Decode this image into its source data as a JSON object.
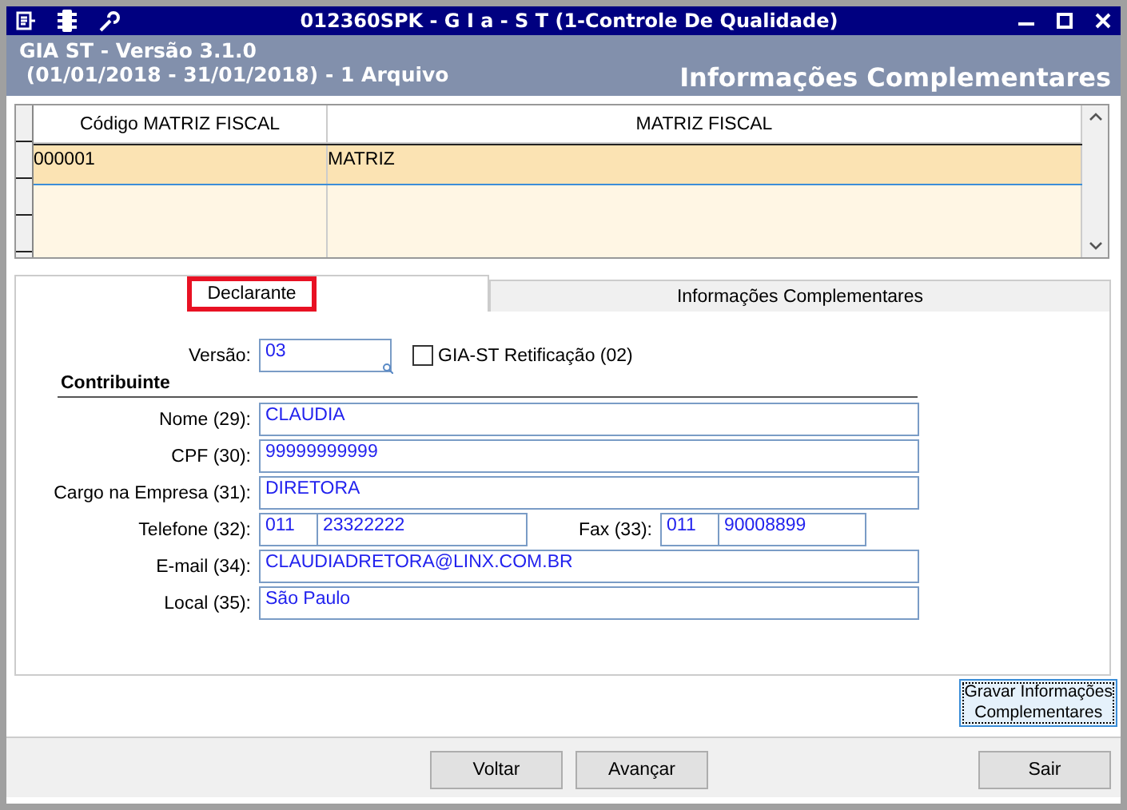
{
  "window": {
    "title": "012360SPK - G I a - S T (1-Controle De Qualidade)"
  },
  "header": {
    "line1": "GIA ST - Versão 3.1.0",
    "line2": " (01/01/2018 - 31/01/2018) - 1 Arquivo",
    "section": "Informações Complementares"
  },
  "table": {
    "columns": [
      "Código MATRIZ FISCAL",
      "MATRIZ FISCAL"
    ],
    "rows": [
      {
        "cells": [
          "000001",
          "MATRIZ"
        ],
        "selected": true
      }
    ]
  },
  "tabs": [
    {
      "label": "Declarante",
      "selected": true,
      "highlighted": true
    },
    {
      "label": "Informações Complementares",
      "selected": false,
      "highlighted": false
    }
  ],
  "form": {
    "version": {
      "label": "Versão:",
      "value": "03"
    },
    "rectification": {
      "label": "GIA-ST Retificação (02)",
      "checked": false
    },
    "section": "Contribuinte",
    "fields": [
      {
        "kind": "text",
        "label": "Nome (29):",
        "value": "CLAUDIA"
      },
      {
        "kind": "text",
        "label": "CPF (30):",
        "value": "99999999999"
      },
      {
        "kind": "text",
        "label": "Cargo na Empresa (31):",
        "value": "DIRETORA"
      },
      {
        "kind": "phones",
        "label": "Telefone (32):",
        "area": "011",
        "number": "23322222",
        "fax_label": "Fax (33):",
        "fax_area": "011",
        "fax_number": "90008899"
      },
      {
        "kind": "text",
        "label": "E-mail (34):",
        "value": "CLAUDIADRETORA@LINX.COM.BR"
      },
      {
        "kind": "text",
        "label": "Local (35):",
        "value": "São Paulo"
      }
    ]
  },
  "save_button": {
    "line1": "Gravar Informações",
    "line2": "Complementares"
  },
  "footer": {
    "back": "Voltar",
    "next": "Avançar",
    "exit": "Sair"
  }
}
